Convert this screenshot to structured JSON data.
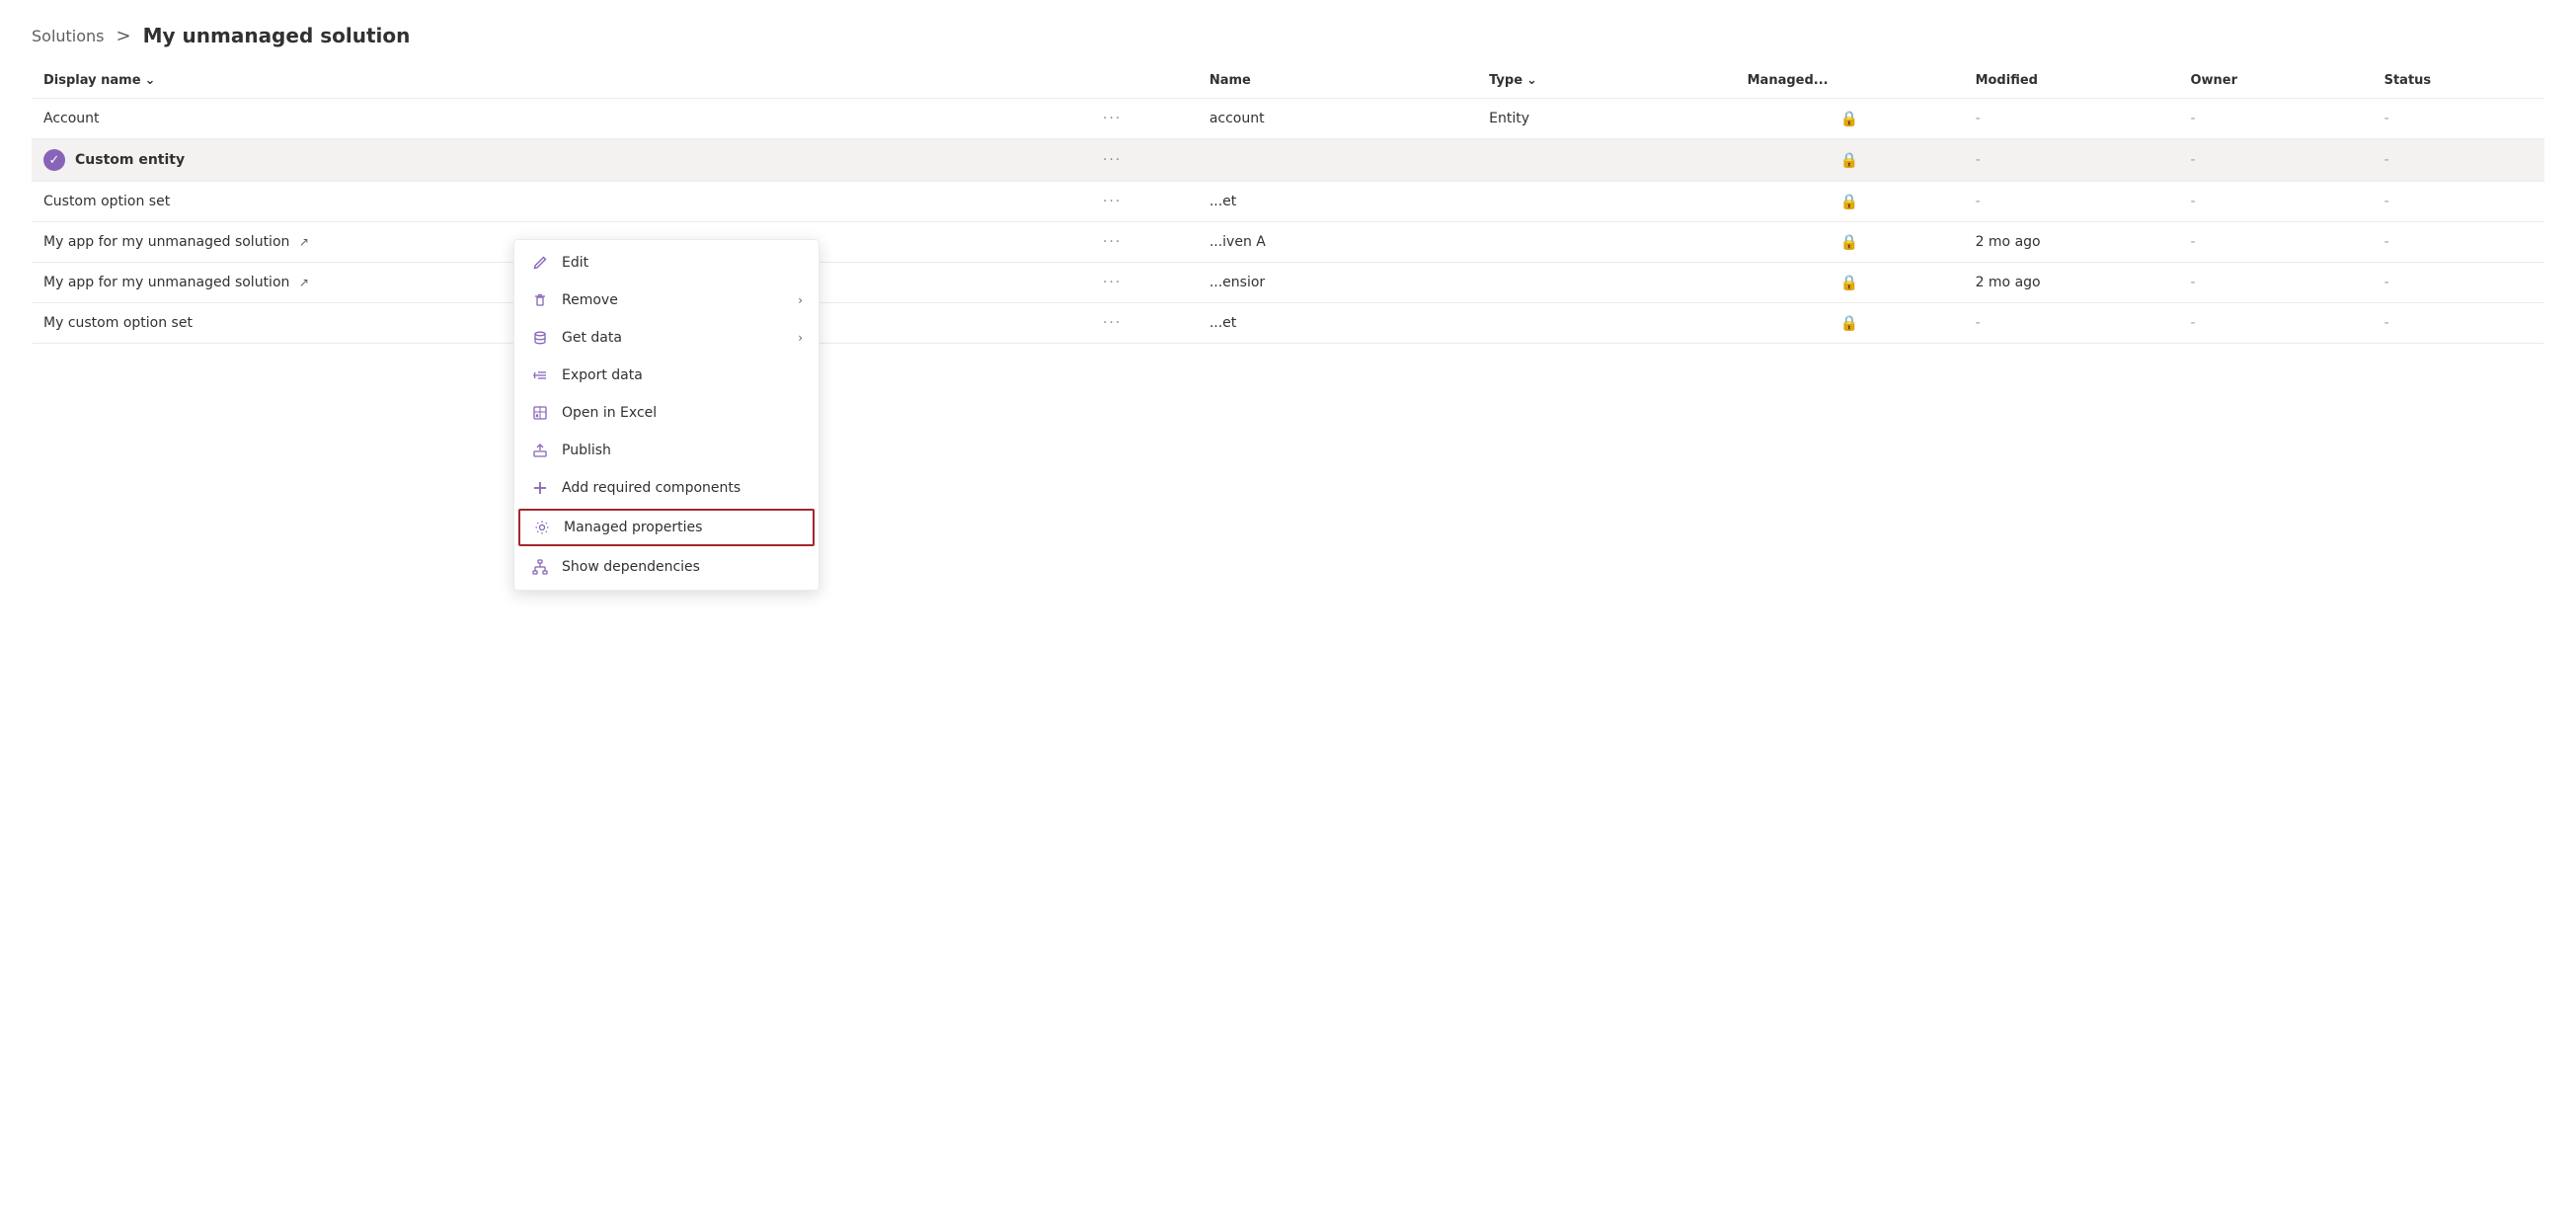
{
  "breadcrumb": {
    "parent": "Solutions",
    "separator": ">",
    "current": "My unmanaged solution"
  },
  "table": {
    "columns": [
      {
        "id": "display_name",
        "label": "Display name",
        "sortable": true
      },
      {
        "id": "dots",
        "label": ""
      },
      {
        "id": "name",
        "label": "Name"
      },
      {
        "id": "type",
        "label": "Type",
        "sortable": true
      },
      {
        "id": "managed",
        "label": "Managed..."
      },
      {
        "id": "modified",
        "label": "Modified"
      },
      {
        "id": "owner",
        "label": "Owner"
      },
      {
        "id": "status",
        "label": "Status"
      }
    ],
    "rows": [
      {
        "id": "row-account",
        "display_name": "Account",
        "has_check": false,
        "has_external_link": false,
        "name": "account",
        "type": "Entity",
        "managed_lock": true,
        "modified": "-",
        "owner": "-",
        "status": "-",
        "selected": false
      },
      {
        "id": "row-custom-entity",
        "display_name": "Custom entity",
        "has_check": true,
        "has_external_link": false,
        "name": "",
        "type": "",
        "managed_lock": true,
        "modified": "-",
        "owner": "-",
        "status": "-",
        "selected": true
      },
      {
        "id": "row-custom-option-set",
        "display_name": "Custom option set",
        "has_check": false,
        "has_external_link": false,
        "name": "...et",
        "type": "",
        "managed_lock": true,
        "modified": "-",
        "owner": "-",
        "status": "-",
        "selected": false
      },
      {
        "id": "row-my-app-1",
        "display_name": "My app for my unmanaged solution",
        "has_check": false,
        "has_external_link": true,
        "name": "...iven A",
        "type": "",
        "managed_lock": true,
        "modified": "2 mo ago",
        "owner": "-",
        "status": "-",
        "selected": false
      },
      {
        "id": "row-my-app-2",
        "display_name": "My app for my unmanaged solution",
        "has_check": false,
        "has_external_link": true,
        "name": "...ensior",
        "type": "",
        "managed_lock": true,
        "modified": "2 mo ago",
        "owner": "-",
        "status": "-",
        "selected": false
      },
      {
        "id": "row-my-custom-option-set",
        "display_name": "My custom option set",
        "has_check": false,
        "has_external_link": false,
        "name": "...et",
        "type": "",
        "managed_lock": true,
        "modified": "-",
        "owner": "-",
        "status": "-",
        "selected": false
      }
    ]
  },
  "context_menu": {
    "items": [
      {
        "id": "edit",
        "label": "Edit",
        "icon": "edit",
        "has_arrow": false,
        "highlighted": false
      },
      {
        "id": "remove",
        "label": "Remove",
        "icon": "trash",
        "has_arrow": true,
        "highlighted": false
      },
      {
        "id": "get-data",
        "label": "Get data",
        "icon": "database",
        "has_arrow": true,
        "highlighted": false
      },
      {
        "id": "export-data",
        "label": "Export data",
        "icon": "export",
        "has_arrow": false,
        "highlighted": false
      },
      {
        "id": "open-excel",
        "label": "Open in Excel",
        "icon": "excel",
        "has_arrow": false,
        "highlighted": false
      },
      {
        "id": "publish",
        "label": "Publish",
        "icon": "publish",
        "has_arrow": false,
        "highlighted": false
      },
      {
        "id": "add-required",
        "label": "Add required components",
        "icon": "plus",
        "has_arrow": false,
        "highlighted": false
      },
      {
        "id": "managed-properties",
        "label": "Managed properties",
        "icon": "gear",
        "has_arrow": false,
        "highlighted": true
      },
      {
        "id": "show-dependencies",
        "label": "Show dependencies",
        "icon": "dependencies",
        "has_arrow": false,
        "highlighted": false
      }
    ]
  }
}
